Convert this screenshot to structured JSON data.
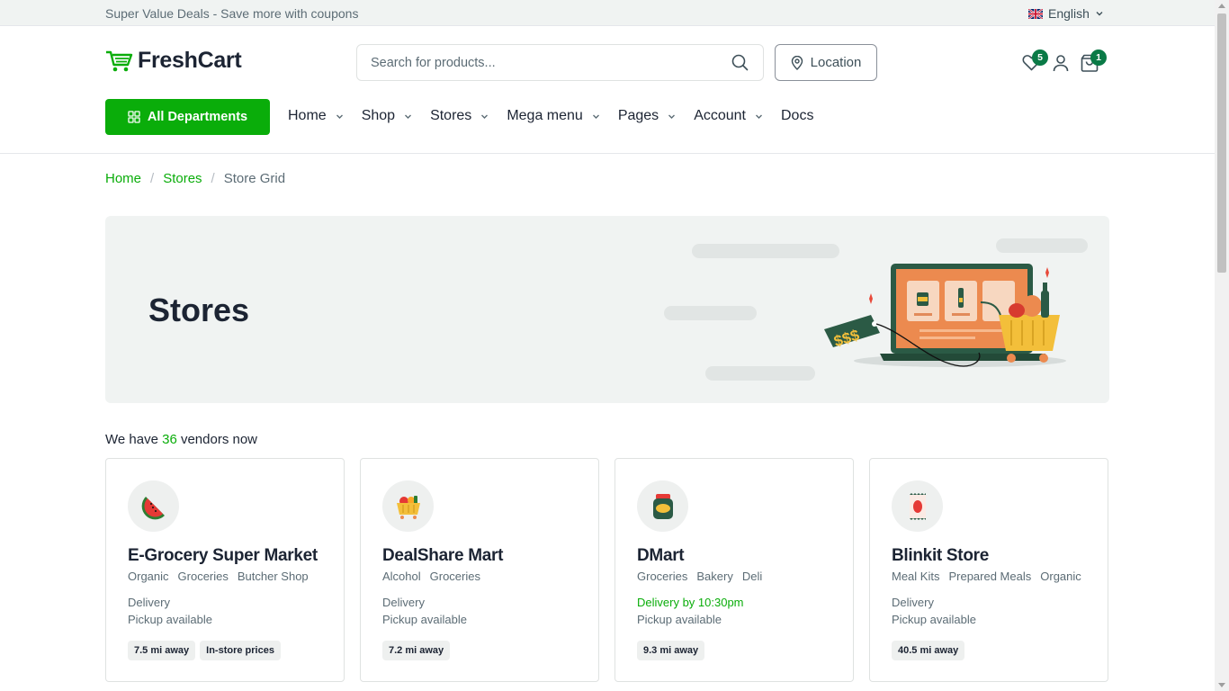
{
  "topbar": {
    "promo": "Super Value Deals - Save more with coupons",
    "language": "English"
  },
  "brand": {
    "name": "FreshCart",
    "accent": "#0aad0a"
  },
  "search": {
    "placeholder": "Search for products..."
  },
  "location_label": "Location",
  "header": {
    "wishlist_count": "5",
    "cart_count": "1"
  },
  "departments_label": "All Departments",
  "nav": [
    "Home",
    "Shop",
    "Stores",
    "Mega menu",
    "Pages",
    "Account",
    "Docs"
  ],
  "breadcrumb": {
    "home": "Home",
    "stores": "Stores",
    "current": "Store Grid"
  },
  "hero": {
    "title": "Stores",
    "price_tag": "$$$"
  },
  "vendors": {
    "prefix": "We have",
    "count": "36",
    "suffix": "vendors now"
  },
  "stores": [
    {
      "name": "E-Grocery Super Market",
      "icon": "watermelon-icon",
      "tags": [
        "Organic",
        "Groceries",
        "Butcher Shop"
      ],
      "delivery": "Delivery",
      "pickup": "Pickup available",
      "chips": [
        "7.5 mi away",
        "In-store prices"
      ]
    },
    {
      "name": "DealShare Mart",
      "icon": "shopping-basket-icon",
      "tags": [
        "Alcohol",
        "Groceries"
      ],
      "delivery": "Delivery",
      "pickup": "Pickup available",
      "chips": [
        "7.2 mi away"
      ]
    },
    {
      "name": "DMart",
      "icon": "jar-icon",
      "tags": [
        "Groceries",
        "Bakery",
        "Deli"
      ],
      "delivery": "Delivery by 10:30pm",
      "pickup": "Pickup available",
      "chips": [
        "9.3 mi away"
      ]
    },
    {
      "name": "Blinkit Store",
      "icon": "snack-pack-icon",
      "tags": [
        "Meal Kits",
        "Prepared Meals",
        "Organic"
      ],
      "delivery": "Delivery",
      "pickup": "Pickup available",
      "chips": [
        "40.5 mi away"
      ]
    }
  ]
}
